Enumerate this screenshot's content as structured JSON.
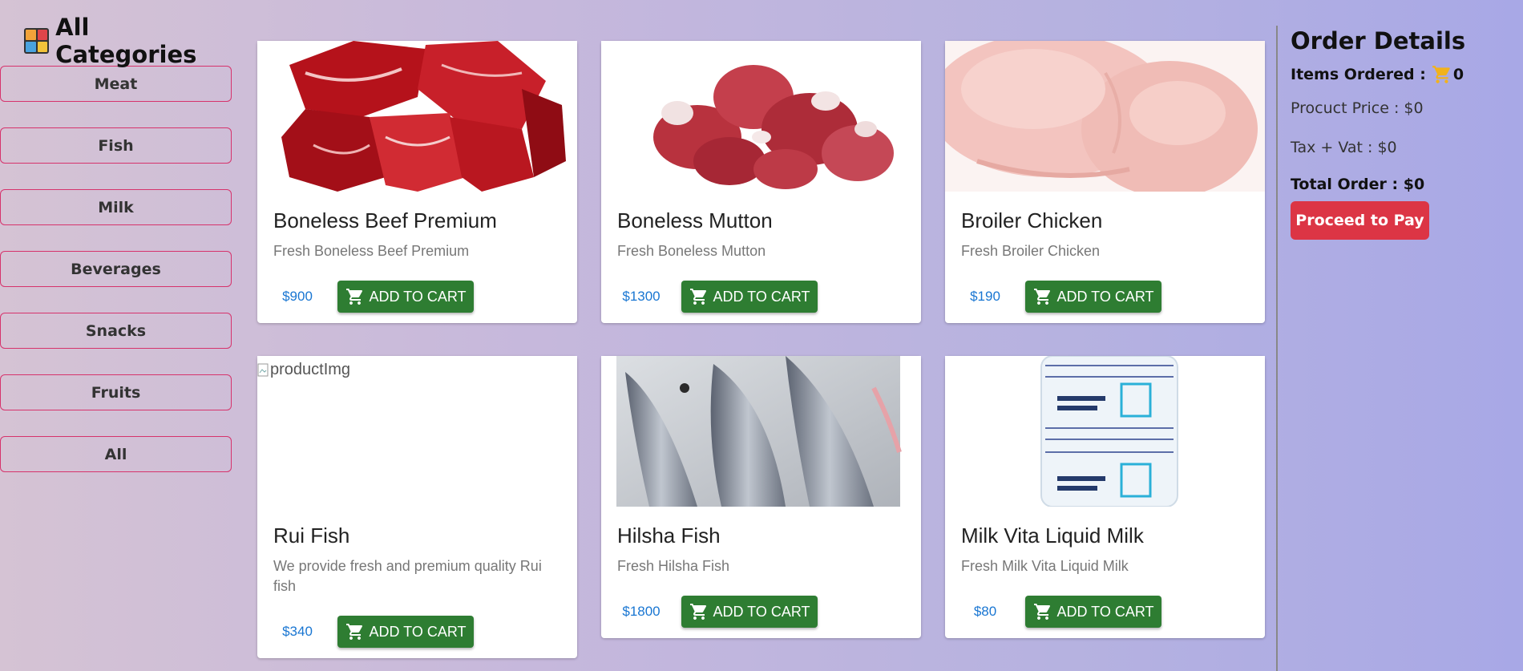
{
  "sidebar": {
    "title": "All Categories",
    "categories": [
      "Meat",
      "Fish",
      "Milk",
      "Beverages",
      "Snacks",
      "Fruits",
      "All"
    ]
  },
  "products": [
    {
      "title": "Boneless Beef Premium",
      "description": "Fresh Boneless Beef Premium",
      "price": "$900",
      "button": "ADD TO CART"
    },
    {
      "title": "Boneless Mutton",
      "description": "Fresh Boneless Mutton",
      "price": "$1300",
      "button": "ADD TO CART"
    },
    {
      "title": "Broiler Chicken",
      "description": "Fresh Broiler Chicken",
      "price": "$190",
      "button": "ADD TO CART"
    },
    {
      "title": "Rui Fish",
      "description": "We provide fresh and premium quality Rui fish",
      "price": "$340",
      "button": "ADD TO CART",
      "image_alt": "productImg"
    },
    {
      "title": "Hilsha Fish",
      "description": "Fresh Hilsha Fish",
      "price": "$1800",
      "button": "ADD TO CART"
    },
    {
      "title": "Milk Vita Liquid Milk",
      "description": "Fresh Milk Vita Liquid Milk",
      "price": "$80",
      "button": "ADD TO CART"
    }
  ],
  "order": {
    "title": "Order Details",
    "items_label": "Items Ordered :",
    "items_count": "0",
    "product_price": "Procuct Price : $0",
    "tax_vat": "Tax + Vat : $0",
    "total": "Total Order : $0",
    "pay_button": "Proceed to Pay"
  },
  "colors": {
    "accent_red": "#dc3545",
    "cart_green": "#2e7d32",
    "price_blue": "#1976d2",
    "category_border": "#d6336c"
  }
}
